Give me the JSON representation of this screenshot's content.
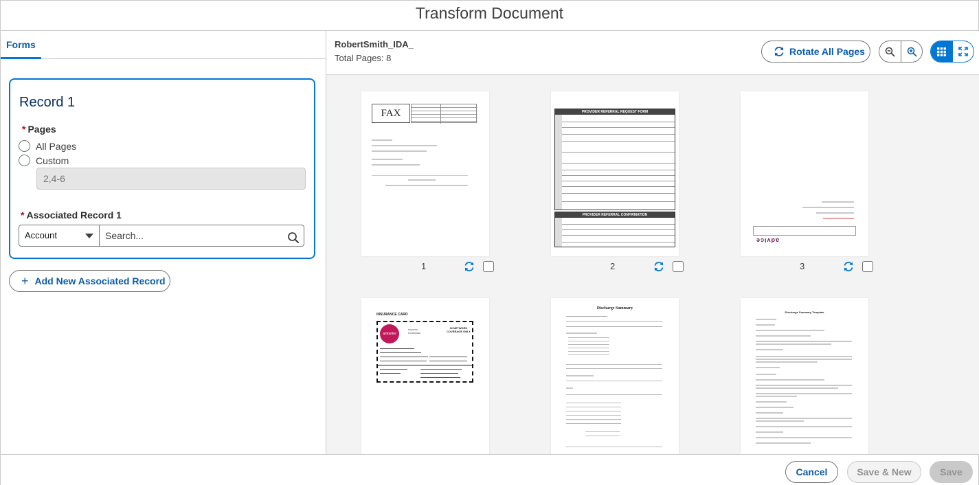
{
  "header": {
    "title": "Transform Document"
  },
  "left": {
    "tab_label": "Forms",
    "record": {
      "title": "Record 1",
      "pages_label": "Pages",
      "option_all": "All Pages",
      "option_custom": "Custom",
      "custom_value": "2,4-6",
      "associated_label": "Associated Record 1",
      "object_select": "Account",
      "search_placeholder": "Search..."
    },
    "add_button": "Add New Associated Record"
  },
  "right": {
    "doc_name": "RobertSmith_IDA_",
    "total_pages": "Total Pages: 8",
    "rotate_all": "Rotate All Pages",
    "pages": [
      {
        "num": "1"
      },
      {
        "num": "2"
      },
      {
        "num": "3"
      }
    ],
    "thumb_text": {
      "fax": "FAX",
      "referral_title": "Provider Referral Request Form",
      "confirmation_title": "Provider Referral Confirmation",
      "insurance_title": "INSURANCE CARD",
      "ambetter": "ambetter",
      "superior": "superior healthplan",
      "in_network": "IN NETWORK COVERAGE ONLY",
      "discharge_title": "Discharge Summary",
      "discharge_template": "Discharge Summary Template",
      "advice": "advice"
    }
  },
  "footer": {
    "cancel": "Cancel",
    "save_new": "Save & New",
    "save": "Save"
  },
  "colors": {
    "brand": "#0176d3",
    "brand_dark": "#0b5cab",
    "required": "#ba0517"
  }
}
